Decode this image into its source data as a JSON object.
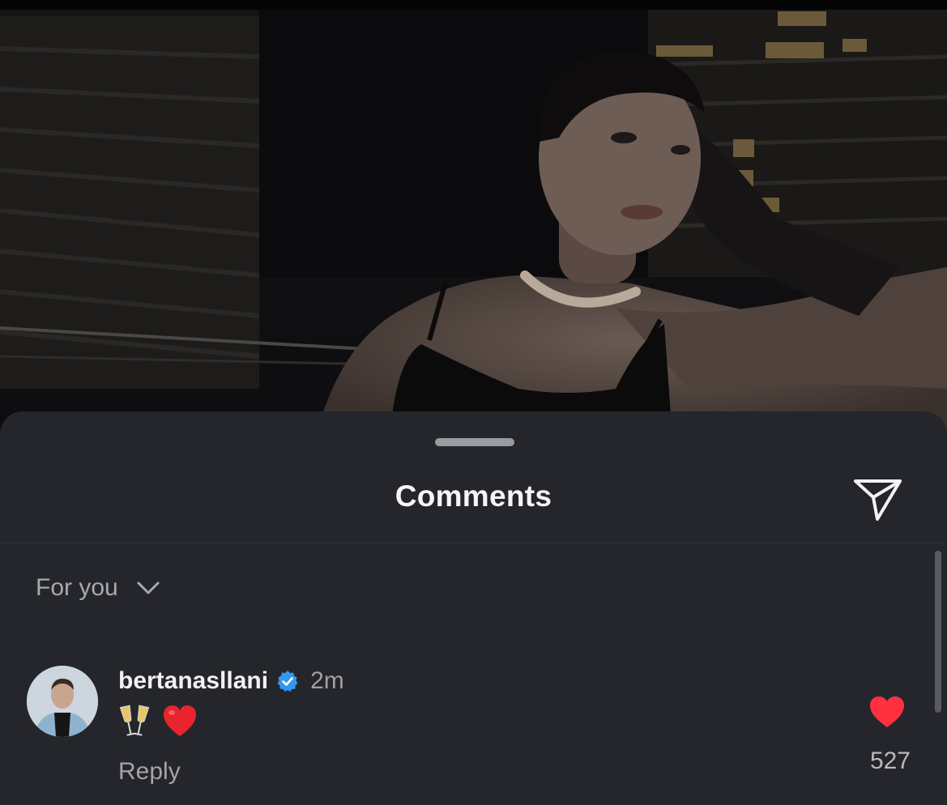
{
  "post": {
    "image_description_icon": "post-photo"
  },
  "comments_sheet": {
    "title": "Comments",
    "share_icon": "send-icon",
    "sort": {
      "label": "For you",
      "icon": "chevron-down-icon"
    }
  },
  "comments": [
    {
      "username": "bertanasllani",
      "verified": true,
      "time": "2m",
      "emojis": [
        "clinking-glasses-icon",
        "red-heart-icon"
      ],
      "reply_label": "Reply",
      "like_count": "527",
      "liked": true
    }
  ],
  "colors": {
    "sheet_bg": "#25262b",
    "like_red": "#ff3040",
    "verified_blue": "#3797f0"
  }
}
